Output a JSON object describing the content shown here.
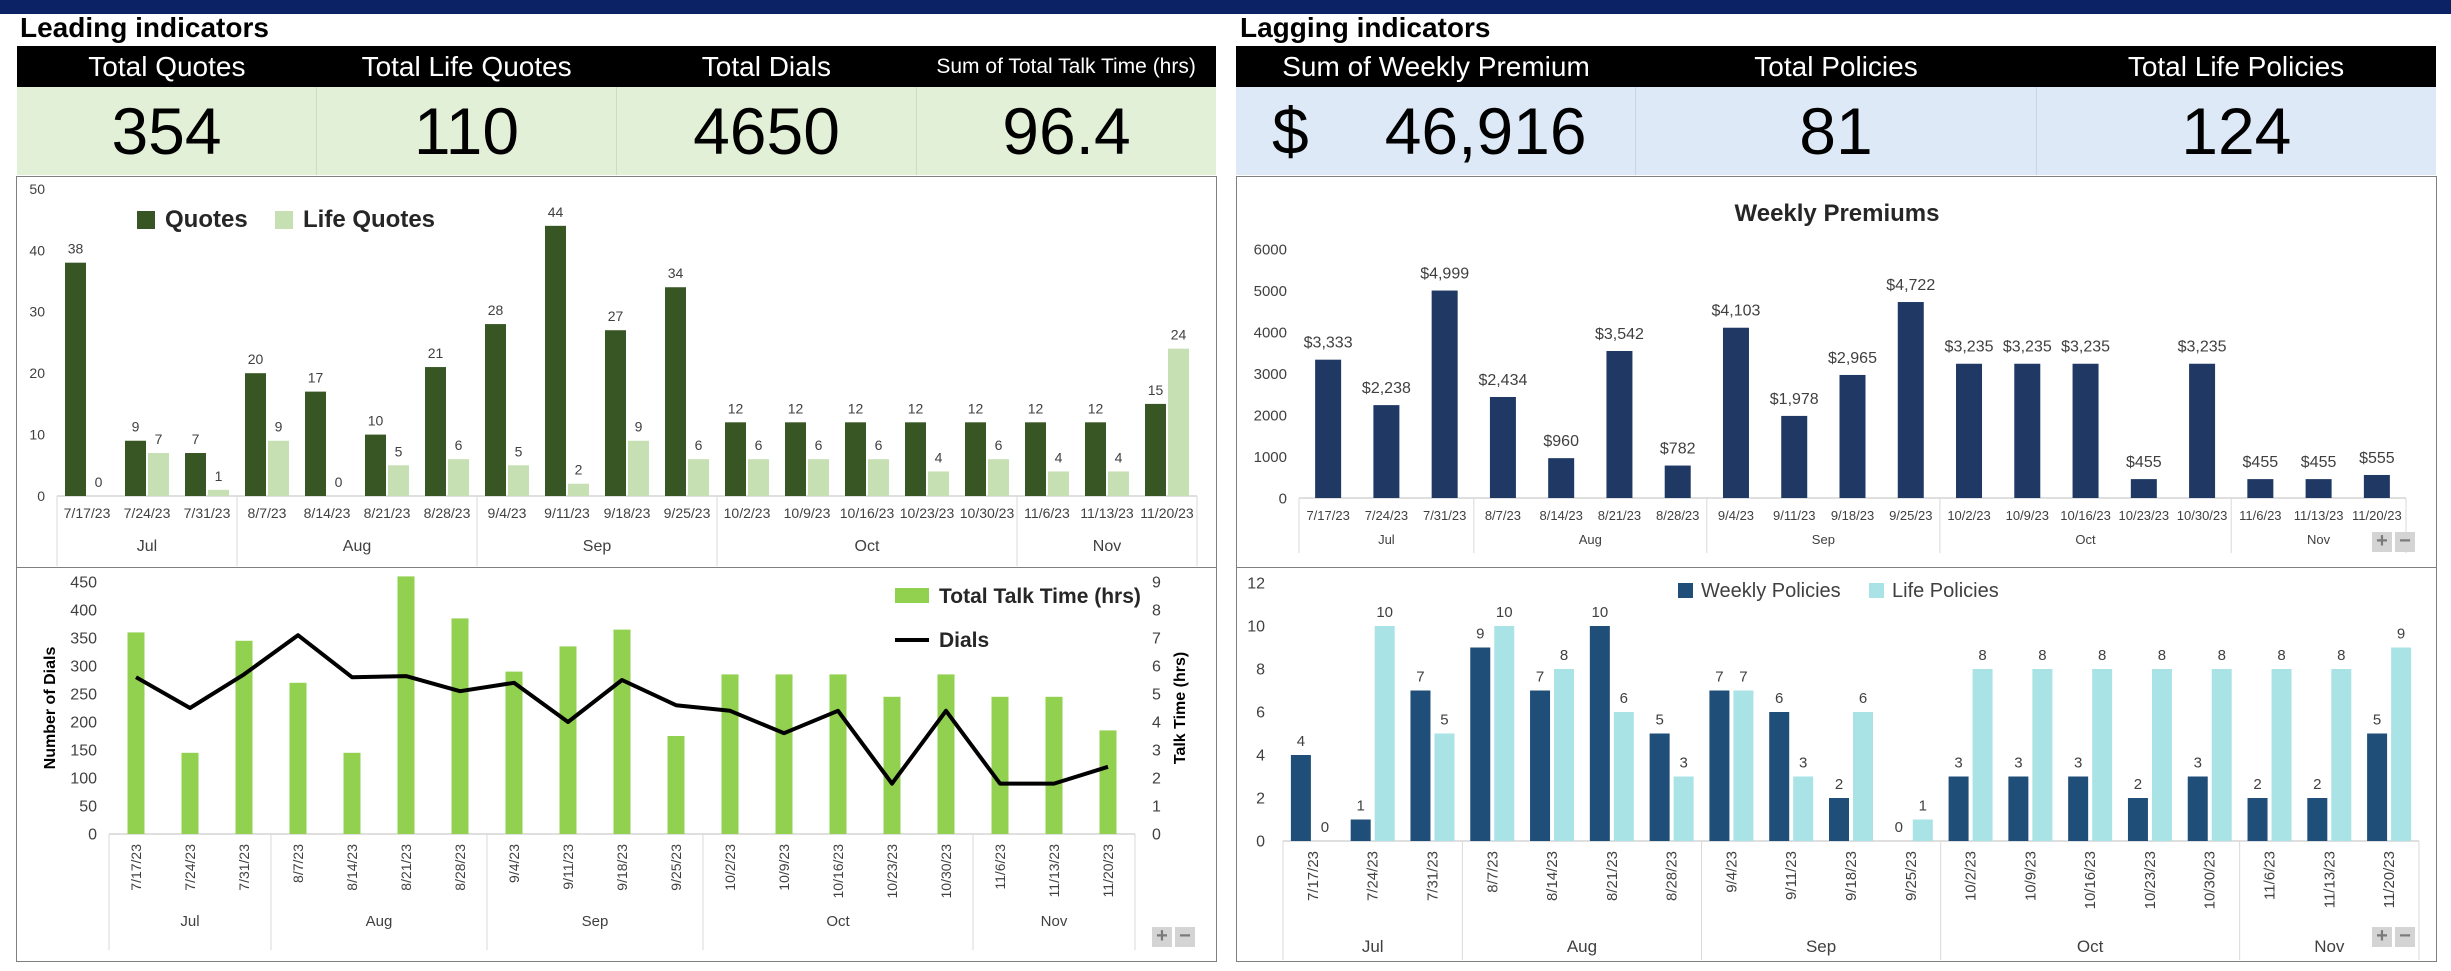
{
  "leading": {
    "title": "Leading indicators",
    "kpis": [
      {
        "label": "Total Quotes",
        "value": "354"
      },
      {
        "label": "Total Life Quotes",
        "value": "110"
      },
      {
        "label": "Total Dials",
        "value": "4650"
      },
      {
        "label": "Sum of Total Talk Time (hrs)",
        "value": "96.4"
      }
    ]
  },
  "lagging": {
    "title": "Lagging indicators",
    "kpis": [
      {
        "label": "Sum of Weekly Premium",
        "prefix": "$",
        "value": "46,916"
      },
      {
        "label": "Total Policies",
        "value": "81"
      },
      {
        "label": "Total Life Policies",
        "value": "124"
      }
    ]
  },
  "colors": {
    "header_bar": "#0b2265",
    "quotes": "#375623",
    "life_quotes": "#c6e0b4",
    "talk_time": "#92d050",
    "dials_line": "#000000",
    "premium": "#1f3864",
    "weekly_policies": "#1f4e79",
    "life_policies": "#a9e3e5"
  },
  "zoom_buttons": {
    "plus": "+",
    "minus": "−"
  },
  "chart_data": [
    {
      "type": "bar",
      "categories": [
        "7/17/23",
        "7/24/23",
        "7/31/23",
        "8/7/23",
        "8/14/23",
        "8/21/23",
        "8/28/23",
        "9/4/23",
        "9/11/23",
        "9/18/23",
        "9/25/23",
        "10/2/23",
        "10/9/23",
        "10/16/23",
        "10/23/23",
        "10/30/23",
        "11/6/23",
        "11/13/23",
        "11/20/23"
      ],
      "groups": [
        {
          "label": "Jul",
          "count": 3
        },
        {
          "label": "Aug",
          "count": 4
        },
        {
          "label": "Sep",
          "count": 4
        },
        {
          "label": "Oct",
          "count": 5
        },
        {
          "label": "Nov",
          "count": 3
        }
      ],
      "series": [
        {
          "name": "Quotes",
          "values": [
            38,
            9,
            7,
            20,
            17,
            10,
            21,
            28,
            44,
            27,
            34,
            12,
            12,
            12,
            12,
            12,
            12,
            12,
            15
          ]
        },
        {
          "name": "Life Quotes",
          "values": [
            0,
            7,
            1,
            9,
            0,
            5,
            6,
            5,
            2,
            9,
            6,
            6,
            6,
            6,
            4,
            6,
            4,
            4,
            24
          ]
        }
      ],
      "ylim": [
        0,
        50
      ],
      "yticks": [
        0,
        10,
        20,
        30,
        40,
        50
      ],
      "legend": "top-left"
    },
    {
      "type": "bar",
      "title": "Weekly Premiums",
      "categories": [
        "7/17/23",
        "7/24/23",
        "7/31/23",
        "8/7/23",
        "8/14/23",
        "8/21/23",
        "8/28/23",
        "9/4/23",
        "9/11/23",
        "9/18/23",
        "9/25/23",
        "10/2/23",
        "10/9/23",
        "10/16/23",
        "10/23/23",
        "10/30/23",
        "11/6/23",
        "11/13/23",
        "11/20/23"
      ],
      "groups": [
        {
          "label": "Jul",
          "count": 3
        },
        {
          "label": "Aug",
          "count": 4
        },
        {
          "label": "Sep",
          "count": 4
        },
        {
          "label": "Oct",
          "count": 5
        },
        {
          "label": "Nov",
          "count": 3
        }
      ],
      "values": [
        3333,
        2238,
        4999,
        2434,
        960,
        3542,
        782,
        4103,
        1978,
        2965,
        4722,
        3235,
        3235,
        3235,
        455,
        3235,
        455,
        455,
        555
      ],
      "labels": [
        "$3,333",
        "$2,238",
        "$4,999",
        "$2,434",
        "$960",
        "$3,542",
        "$782",
        "$4,103",
        "$1,978",
        "$2,965",
        "$4,722",
        "$3,235",
        "$3,235",
        "$3,235",
        "$455",
        "$3,235",
        "$455",
        "$455",
        "$555"
      ],
      "ylim": [
        0,
        6000
      ],
      "yticks": [
        0,
        1000,
        2000,
        3000,
        4000,
        5000,
        6000
      ]
    },
    {
      "type": "bar",
      "categories": [
        "7/17/23",
        "7/24/23",
        "7/31/23",
        "8/7/23",
        "8/14/23",
        "8/21/23",
        "8/28/23",
        "9/4/23",
        "9/11/23",
        "9/18/23",
        "9/25/23",
        "10/2/23",
        "10/9/23",
        "10/16/23",
        "10/23/23",
        "10/30/23",
        "11/6/23",
        "11/13/23",
        "11/20/23"
      ],
      "groups": [
        {
          "label": "Jul",
          "count": 3
        },
        {
          "label": "Aug",
          "count": 4
        },
        {
          "label": "Sep",
          "count": 4
        },
        {
          "label": "Oct",
          "count": 5
        },
        {
          "label": "Nov",
          "count": 3
        }
      ],
      "series": [
        {
          "name": "Total Talk Time (hrs)",
          "type": "bar",
          "axis": "right",
          "values": [
            7.2,
            2.9,
            6.9,
            5.4,
            2.9,
            9.2,
            7.7,
            5.8,
            6.7,
            7.3,
            3.5,
            5.7,
            5.7,
            5.7,
            4.9,
            5.7,
            4.9,
            4.9,
            3.7
          ]
        },
        {
          "name": "Dials",
          "type": "line",
          "axis": "left",
          "values": [
            280,
            225,
            285,
            355,
            280,
            282,
            255,
            270,
            200,
            275,
            230,
            220,
            180,
            220,
            90,
            220,
            90,
            90,
            120
          ]
        }
      ],
      "ylabel": "Number of Dials",
      "y2label": "Talk Time (hrs)",
      "ylim": [
        0,
        450
      ],
      "yticks": [
        0,
        50,
        100,
        150,
        200,
        250,
        300,
        350,
        400,
        450
      ],
      "y2lim": [
        0,
        9
      ],
      "y2ticks": [
        0,
        1,
        2,
        3,
        4,
        5,
        6,
        7,
        8,
        9
      ],
      "legend": "top-right"
    },
    {
      "type": "bar",
      "categories": [
        "7/17/23",
        "7/24/23",
        "7/31/23",
        "8/7/23",
        "8/14/23",
        "8/21/23",
        "8/28/23",
        "9/4/23",
        "9/11/23",
        "9/18/23",
        "9/25/23",
        "10/2/23",
        "10/9/23",
        "10/16/23",
        "10/23/23",
        "10/30/23",
        "11/6/23",
        "11/13/23",
        "11/20/23"
      ],
      "groups": [
        {
          "label": "Jul",
          "count": 3
        },
        {
          "label": "Aug",
          "count": 4
        },
        {
          "label": "Sep",
          "count": 4
        },
        {
          "label": "Oct",
          "count": 5
        },
        {
          "label": "Nov",
          "count": 3
        }
      ],
      "series": [
        {
          "name": "Weekly Policies",
          "values": [
            4,
            1,
            7,
            9,
            7,
            10,
            5,
            7,
            6,
            2,
            0,
            3,
            3,
            3,
            2,
            3,
            2,
            2,
            5
          ]
        },
        {
          "name": "Life Policies",
          "values": [
            0,
            10,
            5,
            10,
            8,
            6,
            3,
            7,
            3,
            6,
            1,
            8,
            8,
            8,
            8,
            8,
            8,
            8,
            9
          ]
        }
      ],
      "ylim": [
        0,
        12
      ],
      "yticks": [
        0,
        2,
        4,
        6,
        8,
        10,
        12
      ],
      "legend": "top-center"
    }
  ]
}
